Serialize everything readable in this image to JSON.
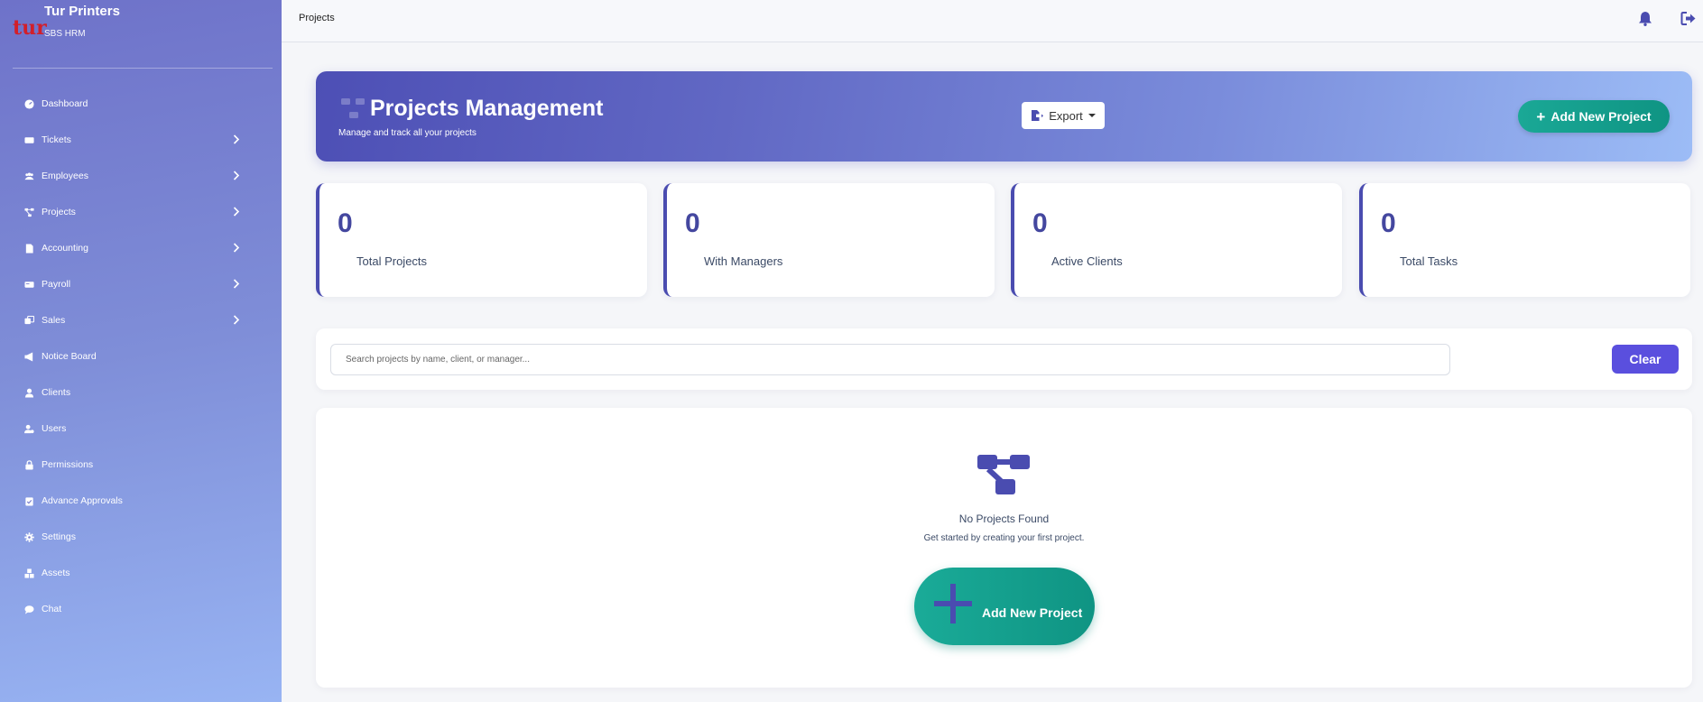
{
  "brand": {
    "logo_text": "tur",
    "name": "Tur Printers",
    "subtitle": "SBS HRM"
  },
  "sidebar": {
    "items": [
      {
        "label": "Dashboard",
        "icon": "dashboard-icon",
        "has_submenu": false
      },
      {
        "label": "Tickets",
        "icon": "ticket-icon",
        "has_submenu": true
      },
      {
        "label": "Employees",
        "icon": "users-icon",
        "has_submenu": true
      },
      {
        "label": "Projects",
        "icon": "project-diagram-icon",
        "has_submenu": true
      },
      {
        "label": "Accounting",
        "icon": "file-invoice-icon",
        "has_submenu": true
      },
      {
        "label": "Payroll",
        "icon": "money-bill-icon",
        "has_submenu": true
      },
      {
        "label": "Sales",
        "icon": "layer-group-icon",
        "has_submenu": true
      },
      {
        "label": "Notice Board",
        "icon": "bullhorn-icon",
        "has_submenu": false
      },
      {
        "label": "Clients",
        "icon": "user-icon",
        "has_submenu": false
      },
      {
        "label": "Users",
        "icon": "user-cog-icon",
        "has_submenu": false
      },
      {
        "label": "Permissions",
        "icon": "lock-icon",
        "has_submenu": false
      },
      {
        "label": "Advance Approvals",
        "icon": "clipboard-check-icon",
        "has_submenu": false
      },
      {
        "label": "Settings",
        "icon": "gear-icon",
        "has_submenu": false
      },
      {
        "label": "Assets",
        "icon": "boxes-icon",
        "has_submenu": false
      },
      {
        "label": "Chat",
        "icon": "chat-icon",
        "has_submenu": false
      }
    ]
  },
  "topbar": {
    "breadcrumb": "Projects",
    "icons": [
      "bell-icon",
      "logout-icon"
    ]
  },
  "hero": {
    "title": "Projects Management",
    "subtitle": "Manage and track all your projects",
    "export_label": "Export",
    "add_label": "Add New Project"
  },
  "stats": [
    {
      "value": "0",
      "label": "Total Projects"
    },
    {
      "value": "0",
      "label": "With Managers"
    },
    {
      "value": "0",
      "label": "Active Clients"
    },
    {
      "value": "0",
      "label": "Total Tasks"
    }
  ],
  "search": {
    "placeholder": "Search projects by name, client, or manager...",
    "value": "",
    "clear_label": "Clear"
  },
  "empty": {
    "title": "No Projects Found",
    "subtitle": "Get started by creating your first project.",
    "add_label": "Add New Project"
  },
  "colors": {
    "accent": "#4a4cb0",
    "teal": "#14a08e",
    "clear_button": "#5a4fde",
    "brand_logo": "#d21f2a"
  }
}
